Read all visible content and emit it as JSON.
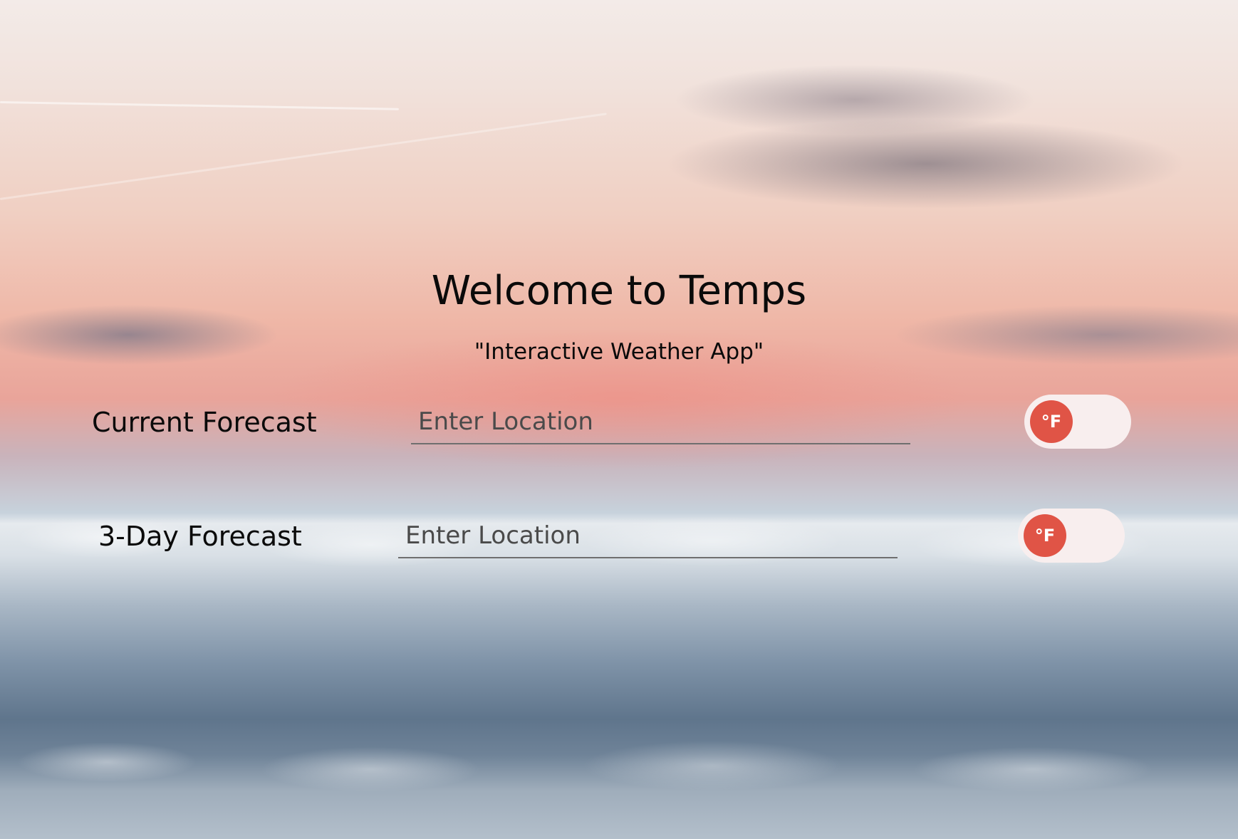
{
  "header": {
    "title": "Welcome to Temps",
    "subtitle": "\"Interactive Weather App\""
  },
  "current_forecast": {
    "label": "Current Forecast",
    "input_placeholder": "Enter Location",
    "input_value": "",
    "unit_toggle_label": "°F"
  },
  "three_day_forecast": {
    "label": "3-Day Forecast",
    "input_placeholder": "Enter Location",
    "input_value": "",
    "unit_toggle_label": "°F"
  },
  "colors": {
    "toggle_knob": "#e05446",
    "toggle_track": "#f8eeee",
    "text": "#0a0a0a"
  }
}
